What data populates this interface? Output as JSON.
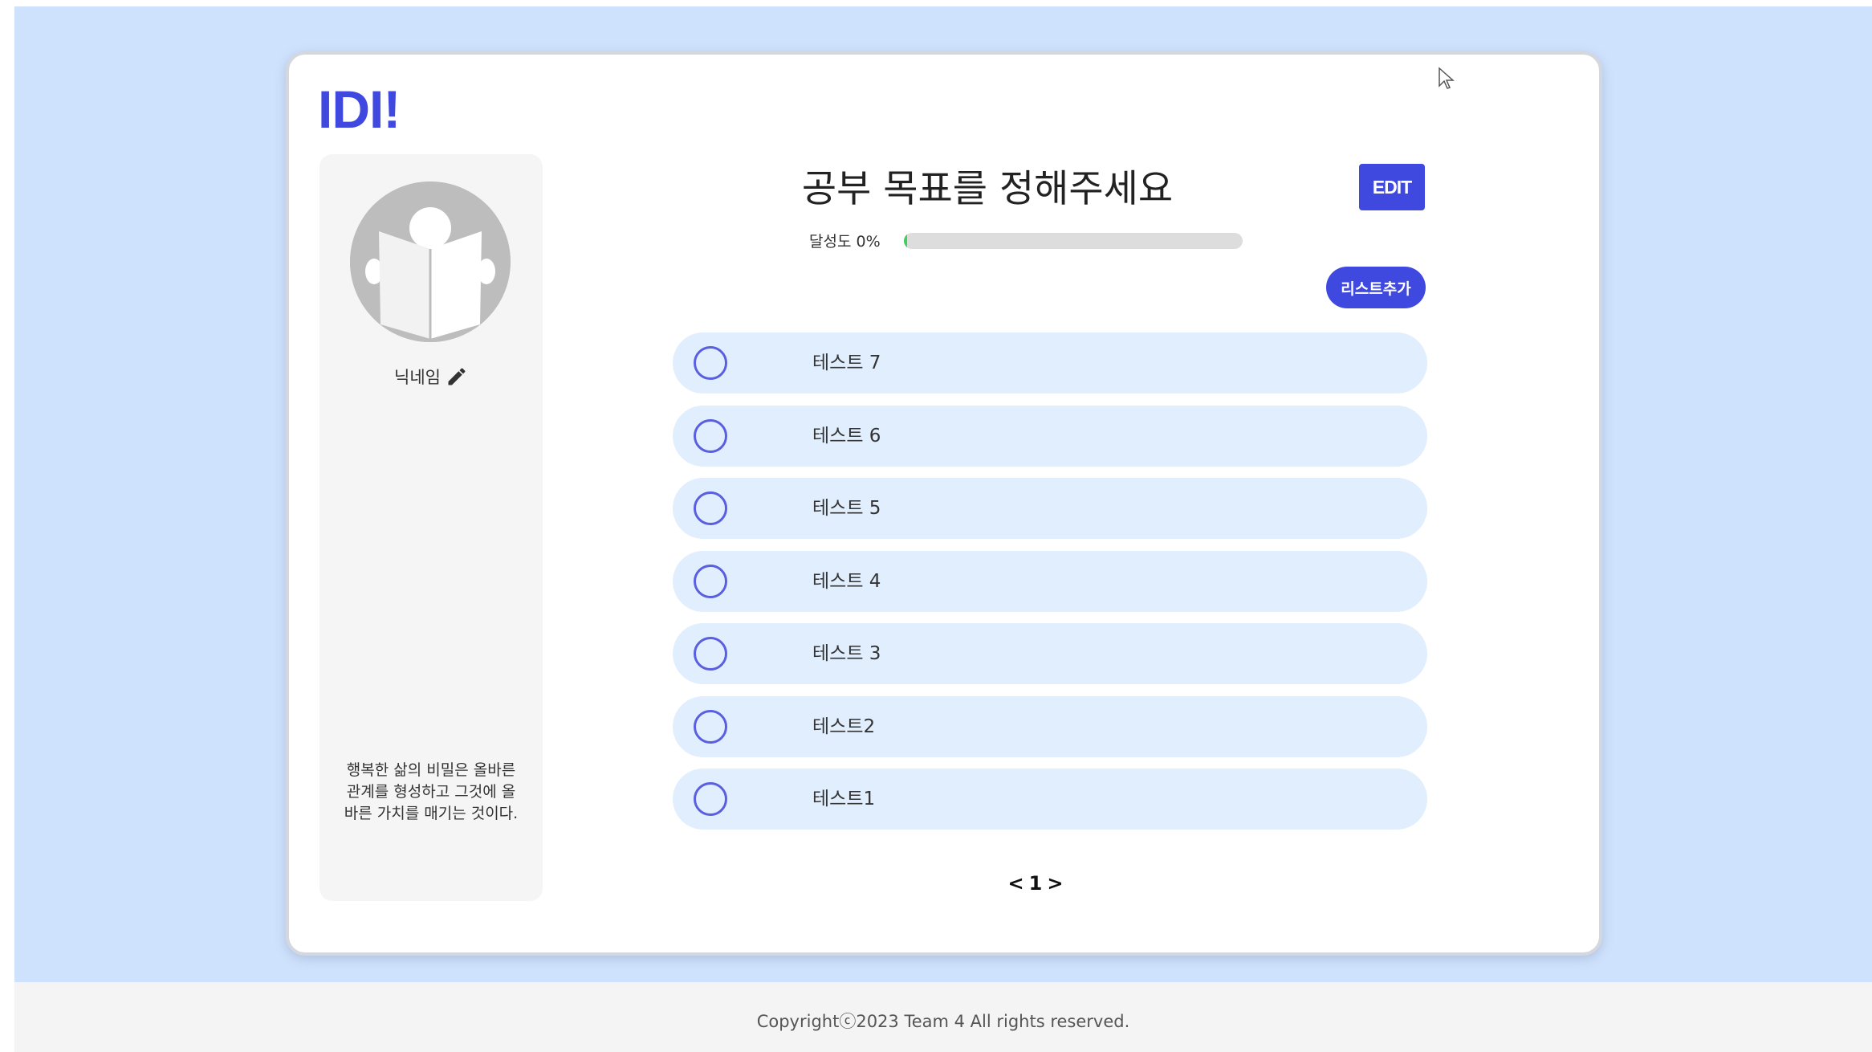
{
  "header": {
    "logo": "IDI!"
  },
  "profile": {
    "nickname": "닉네임",
    "quote": "행복한 삶의 비밀은 올바른 관계를 형성하고 그것에 올바른 가치를 매기는 것이다."
  },
  "goal": {
    "title": "공부 목표를 정해주세요",
    "edit_label": "EDIT",
    "progress_label": "달성도 0%",
    "progress_value": 0,
    "add_label": "리스트추가"
  },
  "todos": [
    {
      "text": "테스트 7",
      "done": false
    },
    {
      "text": "테스트 6",
      "done": false
    },
    {
      "text": "테스트 5",
      "done": false
    },
    {
      "text": "테스트 4",
      "done": false
    },
    {
      "text": "테스트 3",
      "done": false
    },
    {
      "text": "테스트2",
      "done": false
    },
    {
      "text": "테스트1",
      "done": false
    }
  ],
  "pagination": {
    "prev": "<",
    "current": "1",
    "next": ">"
  },
  "footer": {
    "copyright": "Copyrightⓒ2023 Team 4 All rights reserved."
  },
  "colors": {
    "accent": "#3f49e0",
    "page_bg": "#cfe2fd",
    "item_bg": "#e1eefe",
    "progress": "#3fcf5a"
  },
  "icons": {
    "avatar": "reading-person-icon",
    "nickname_edit": "pencil-icon",
    "todo_check": "circle-checkbox-icon",
    "cursor": "mouse-pointer-icon"
  }
}
